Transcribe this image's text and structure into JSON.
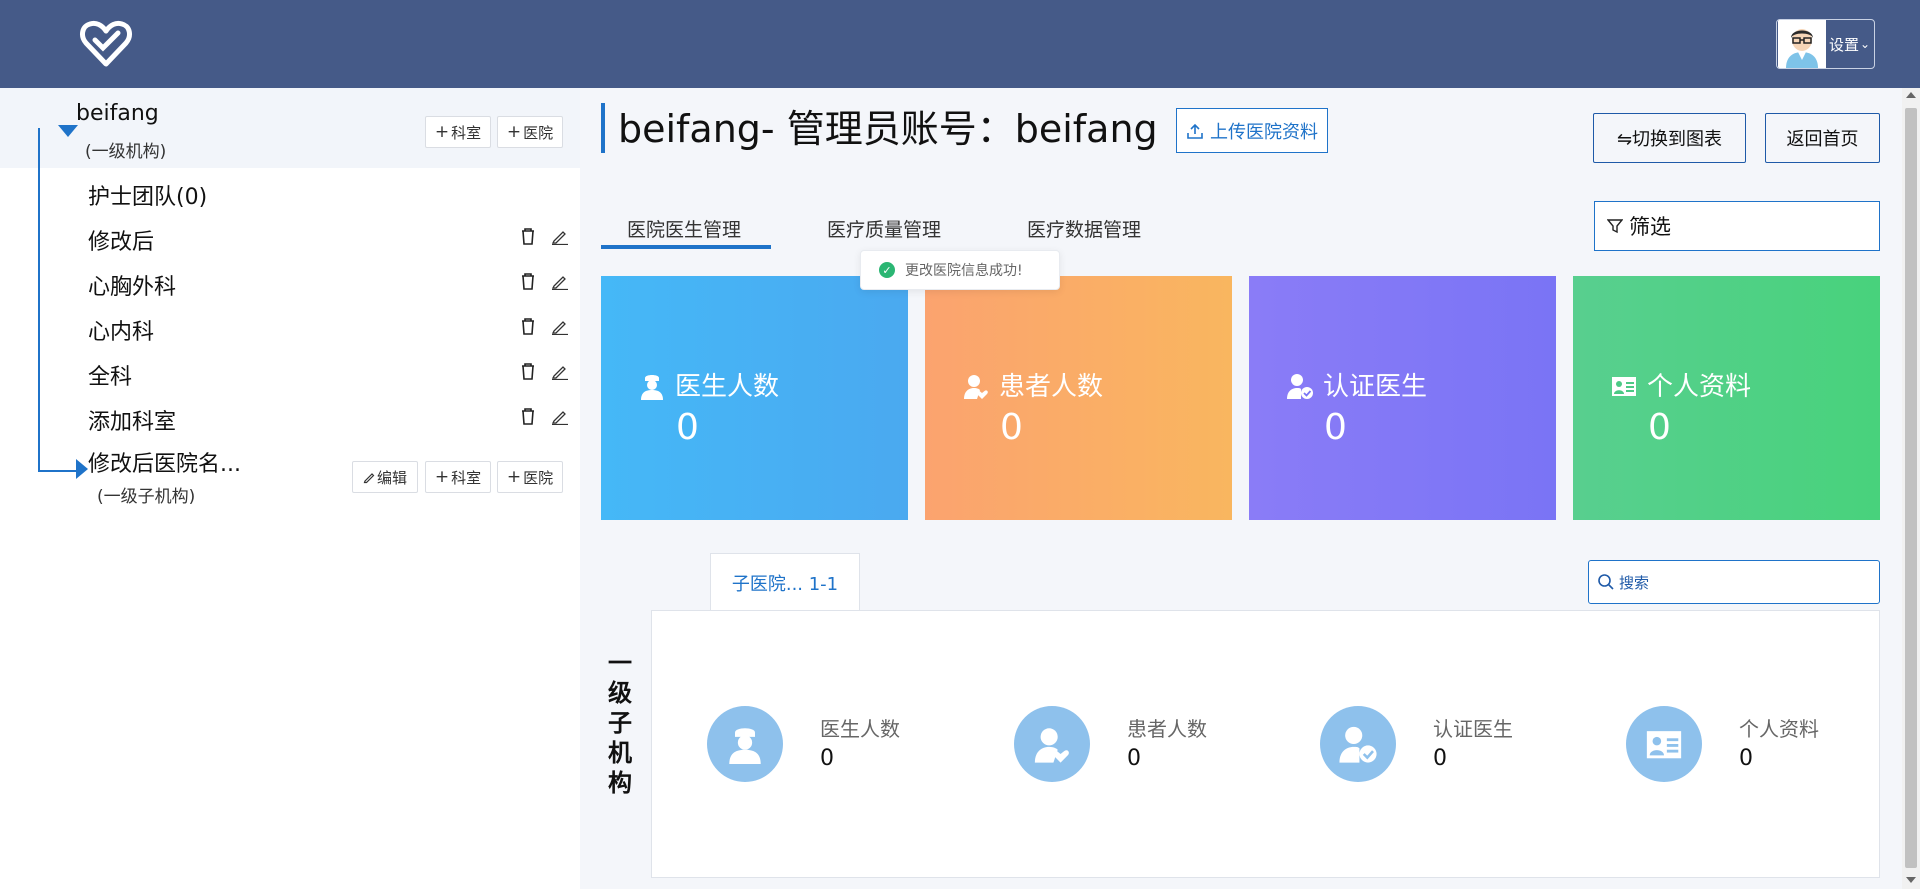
{
  "header": {
    "user_menu_label": "设置"
  },
  "sidebar": {
    "root": {
      "name": "beifang",
      "level": "(一级机构)",
      "add_dept": "科室",
      "add_hospital": "医院"
    },
    "departments": [
      {
        "name": "护士团队(0)"
      },
      {
        "name": "修改后"
      },
      {
        "name": "心胸外科"
      },
      {
        "name": "心内科"
      },
      {
        "name": "全科"
      },
      {
        "name": "添加科室"
      }
    ],
    "child": {
      "name": "修改后医院名...",
      "level": "(一级子机构)",
      "edit": "编辑",
      "add_dept": "科室",
      "add_hospital": "医院"
    }
  },
  "main": {
    "title": "beifang- 管理员账号：beifang",
    "upload_label": "上传医院资料",
    "switch_chart_label": "⇋切换到图表",
    "back_home_label": "返回首页",
    "tabs": [
      {
        "label": "医院医生管理"
      },
      {
        "label": "医疗质量管理"
      },
      {
        "label": "医疗数据管理"
      }
    ],
    "filter_label": "筛选",
    "toast": "更改医院信息成功!",
    "cards": [
      {
        "label": "医生人数",
        "value": "0",
        "icon": "doctor-icon"
      },
      {
        "label": "患者人数",
        "value": "0",
        "icon": "patient-icon"
      },
      {
        "label": "认证医生",
        "value": "0",
        "icon": "verified-doctor-icon"
      },
      {
        "label": "个人资料",
        "value": "0",
        "icon": "profile-card-icon"
      }
    ],
    "subtab_label": "子医院... 1-1",
    "search_placeholder": "搜索",
    "section_label": "一级子机构",
    "stats": [
      {
        "label": "医生人数",
        "value": "0",
        "icon": "doctor-icon"
      },
      {
        "label": "患者人数",
        "value": "0",
        "icon": "patient-icon"
      },
      {
        "label": "认证医生",
        "value": "0",
        "icon": "verified-doctor-icon"
      },
      {
        "label": "个人资料",
        "value": "0",
        "icon": "profile-card-icon"
      }
    ]
  },
  "colors": {
    "header_bg": "#455a88",
    "accent": "#1f73c9",
    "card_doctor": "#45b0f5",
    "card_patient": "#f9a86a",
    "card_verified": "#8077f7",
    "card_profile": "#4ccf86",
    "stat_circle": "#8ec1ec"
  }
}
